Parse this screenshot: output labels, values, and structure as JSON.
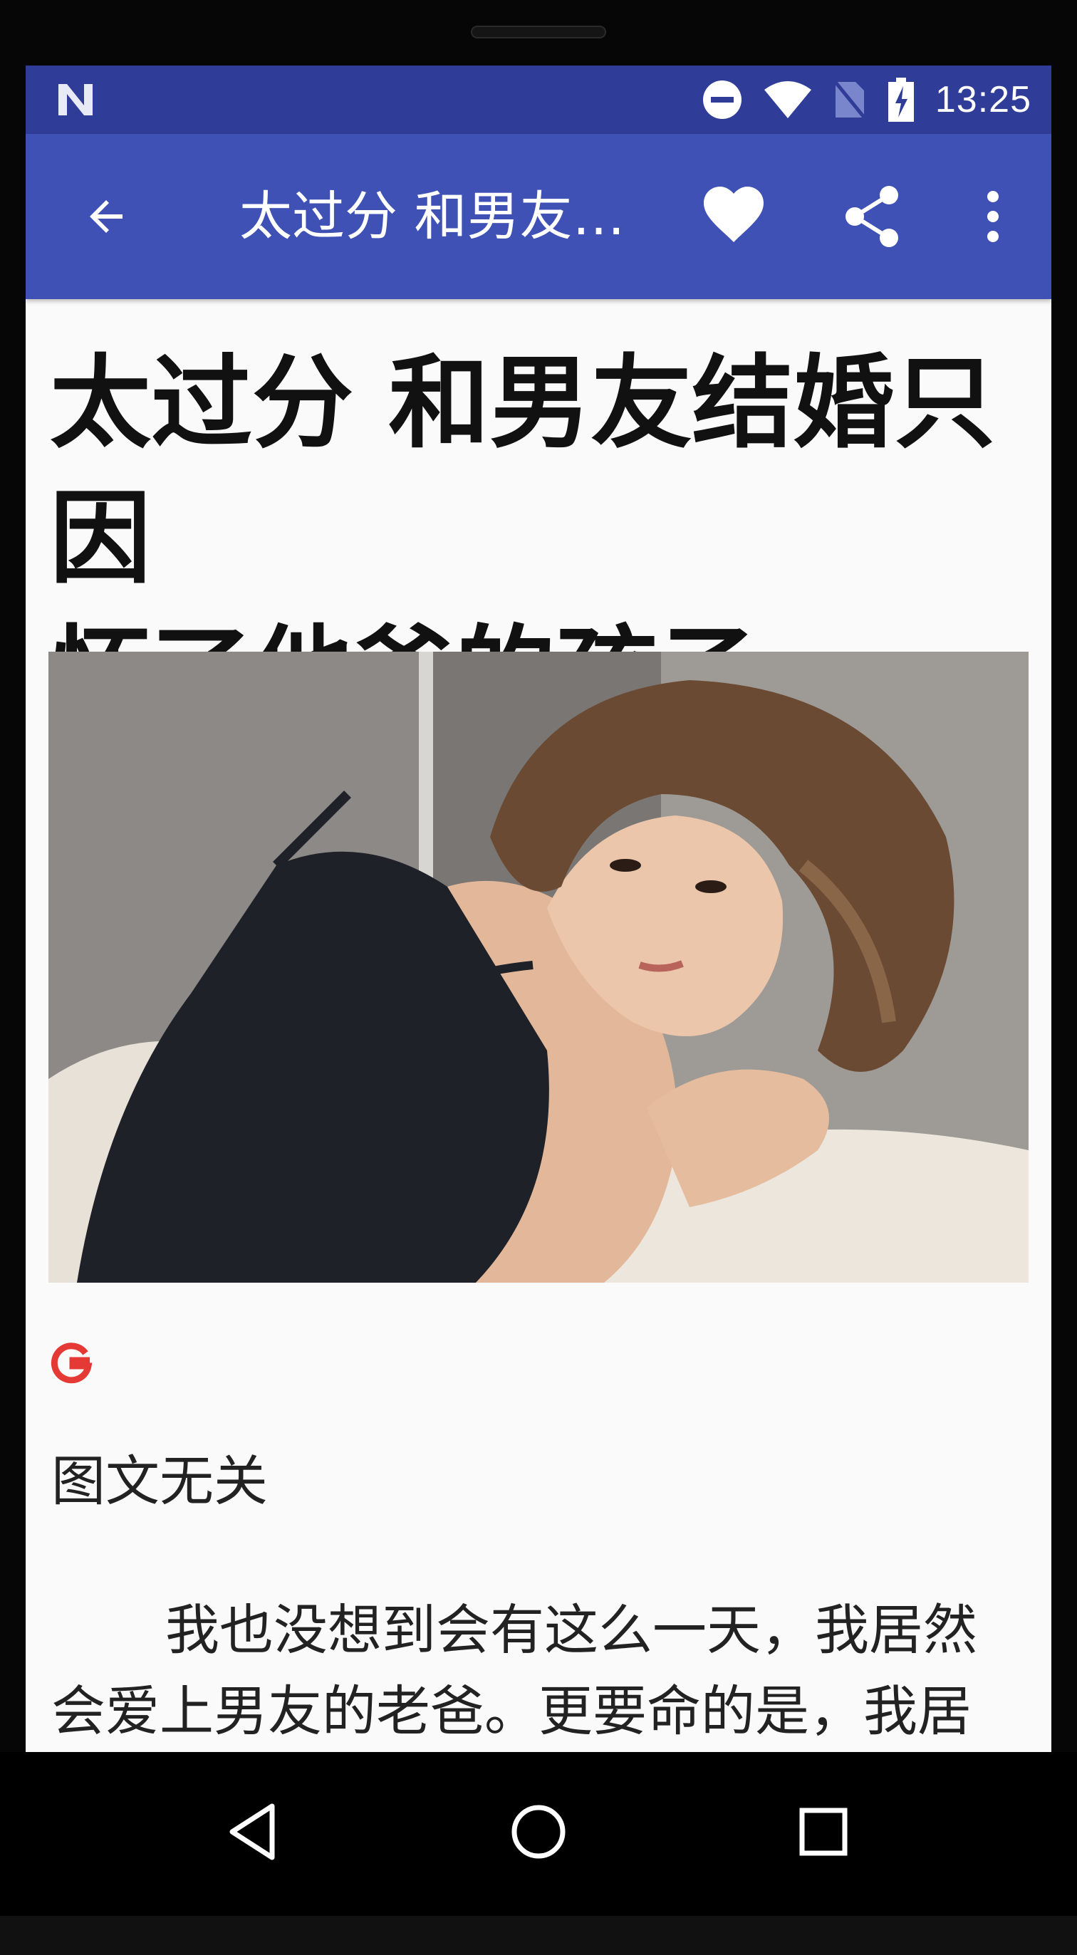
{
  "status_bar": {
    "time": "13:25",
    "icons": [
      "n-logo-icon",
      "do-not-disturb-icon",
      "wifi-icon",
      "no-sim-icon",
      "battery-charging-icon"
    ]
  },
  "app_bar": {
    "title": "太过分 和男友…",
    "actions": [
      "back-arrow-icon",
      "heart-icon",
      "share-icon",
      "more-vert-icon"
    ],
    "color": "#3f51b5",
    "status_color": "#2f3d99"
  },
  "article": {
    "title_line1": "太过分 和男友结婚只因",
    "title_line2": "怀了他爸的孩子",
    "image_alt": "photo",
    "caption": "图文无关",
    "body_line1": "我也没想到会有这么一天，我居然",
    "body_line2": "会爱上男友的老爸。更要命的是，我居"
  },
  "nav_bar": {
    "buttons": [
      "back-triangle-icon",
      "home-circle-icon",
      "recents-square-icon"
    ]
  }
}
